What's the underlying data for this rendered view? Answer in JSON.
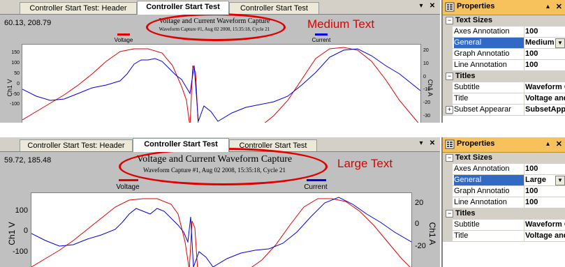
{
  "panels": [
    {
      "tabs": [
        "Controller Start Test: Header",
        "Controller Start Test",
        "Controller Start Test"
      ],
      "active_tab_index": 1,
      "coords": "60.13, 208.79",
      "plot_title": "Voltage and Current Waveform Capture",
      "plot_subtitle": "Waveform Capture #1, Aug 02 2008, 15:35:18,  Cycle 21",
      "legend": [
        {
          "label": "Voltage",
          "color": "#e00000"
        },
        {
          "label": "Current",
          "color": "#0000e0"
        }
      ],
      "left_axis_label": "Ch1 V",
      "right_axis_label": "Ch1 A",
      "left_ticks": [
        "150",
        "100",
        "50",
        "0",
        "-50",
        "-100"
      ],
      "right_ticks": [
        "20",
        "10",
        "0",
        "-10",
        "-20",
        "-30"
      ],
      "annotation": "Medium Text",
      "properties": {
        "title": "Properties",
        "categories": [
          {
            "label": "Text Sizes",
            "expanded": true,
            "rows": [
              {
                "name": "Axes Annotation",
                "value": "100",
                "selected": false,
                "dropdown": false
              },
              {
                "name": "General",
                "value": "Medium",
                "selected": true,
                "dropdown": true
              },
              {
                "name": "Graph Annotatio",
                "value": "100",
                "selected": false,
                "dropdown": false
              },
              {
                "name": "Line Annotation",
                "value": "100",
                "selected": false,
                "dropdown": false
              }
            ]
          },
          {
            "label": "Titles",
            "expanded": true,
            "rows": [
              {
                "name": "Subtitle",
                "value": "Waveform Ca",
                "selected": false,
                "dropdown": false
              },
              {
                "name": "Title",
                "value": "Voltage and",
                "selected": false,
                "dropdown": false
              }
            ]
          },
          {
            "label": "Subset Appearar",
            "value": "SubsetAppea",
            "expanded": false,
            "rows": []
          }
        ]
      }
    },
    {
      "tabs": [
        "Controller Start Test: Header",
        "Controller Start Test",
        "Controller Start Test"
      ],
      "active_tab_index": 1,
      "coords": "59.72, 185.48",
      "plot_title": "Voltage and Current Waveform Capture",
      "plot_subtitle": "Waveform Capture #1, Aug 02 2008, 15:35:18,  Cycle 21",
      "legend": [
        {
          "label": "Voltage",
          "color": "#e00000"
        },
        {
          "label": "Current",
          "color": "#0000e0"
        }
      ],
      "left_axis_label": "Ch1 V",
      "right_axis_label": "Ch1 A",
      "left_ticks": [
        "100",
        "0",
        "-100"
      ],
      "right_ticks": [
        "20",
        "0",
        "-20"
      ],
      "annotation": "Large Text",
      "properties": {
        "title": "Properties",
        "categories": [
          {
            "label": "Text Sizes",
            "expanded": true,
            "rows": [
              {
                "name": "Axes Annotation",
                "value": "100",
                "selected": false,
                "dropdown": false
              },
              {
                "name": "General",
                "value": "Large",
                "selected": true,
                "dropdown": true
              },
              {
                "name": "Graph Annotatio",
                "value": "100",
                "selected": false,
                "dropdown": false
              },
              {
                "name": "Line Annotation",
                "value": "100",
                "selected": false,
                "dropdown": false
              }
            ]
          },
          {
            "label": "Titles",
            "expanded": true,
            "rows": [
              {
                "name": "Subtitle",
                "value": "Waveform Ca",
                "selected": false,
                "dropdown": false
              },
              {
                "name": "Title",
                "value": "Voltage and",
                "selected": false,
                "dropdown": false
              }
            ]
          }
        ]
      }
    }
  ],
  "colors": {
    "voltage": "#e00000",
    "current": "#0000e0",
    "annotation": "#e00000",
    "selected": "#316ac5",
    "props_header": "#f7c15c"
  },
  "icons": {
    "dropdown": "chevron-down-icon",
    "close": "close-icon",
    "pin": "pin-icon",
    "properties": "properties-icon"
  }
}
